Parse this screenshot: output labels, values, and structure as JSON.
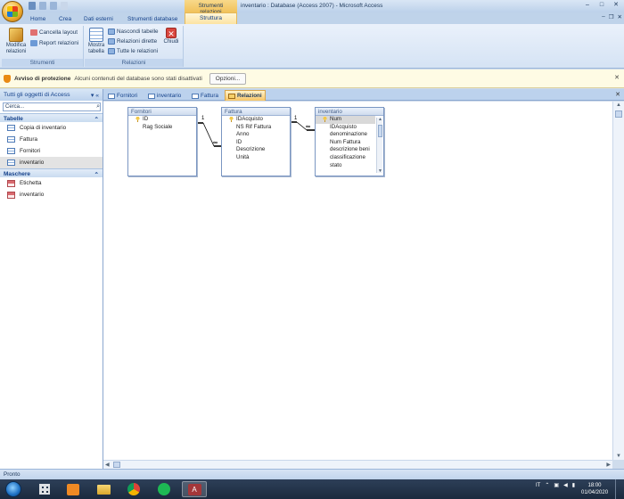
{
  "titlebar": {
    "context_tab": "Strumenti relazioni",
    "title": "inventario : Database (Access 2007) - Microsoft Access",
    "controls": [
      "–",
      "□",
      "✕"
    ]
  },
  "ribbon_tabs": [
    "Home",
    "Crea",
    "Dati esterni",
    "Strumenti database",
    "Struttura"
  ],
  "ribbon_active_tab": "Struttura",
  "ribbon": {
    "strumenti": {
      "label": "Strumenti",
      "modifica": "Modifica relazioni",
      "cancella": "Cancella layout",
      "report": "Report relazioni"
    },
    "relazioni": {
      "label": "Relazioni",
      "mostra": "Mostra tabella",
      "nascondi": "Nascondi tabelle",
      "dirette": "Relazioni dirette",
      "tutte": "Tutte le relazioni",
      "chiudi": "Chiudi"
    }
  },
  "security": {
    "title": "Avviso di protezione",
    "message": "Alcuni contenuti del database sono stati disattivati",
    "button": "Opzioni..."
  },
  "nav": {
    "header": "Tutti gli oggetti di Access",
    "search_placeholder": "Cerca...",
    "sections": [
      {
        "label": "Tabelle",
        "items": [
          "Copia di inventario",
          "Fattura",
          "Fornitori",
          "inventario"
        ]
      },
      {
        "label": "Maschere",
        "items": [
          "Etichetta",
          "inventario"
        ]
      }
    ],
    "selected": "inventario"
  },
  "doc_tabs": [
    "Fornitori",
    "inventario",
    "Fattura",
    "Relazioni"
  ],
  "doc_active_tab": "Relazioni",
  "relations": {
    "tables": [
      {
        "name": "Fornitori",
        "fields": [
          "ID",
          "Rag Sociale"
        ],
        "key_field": "ID"
      },
      {
        "name": "Fattura",
        "fields": [
          "IDAcquisto",
          "NS Rif Fattura",
          "Anno",
          "ID",
          "Descrizione",
          "Unità"
        ],
        "key_field": "IDAcquisto"
      },
      {
        "name": "inventario",
        "fields": [
          "Num",
          "IDAcquisto",
          "denominazione",
          "Num Fattura",
          "descrizione beni",
          "classificazione",
          "stato"
        ],
        "key_field": "Num"
      }
    ],
    "links": [
      {
        "from": "Fornitori.ID",
        "to": "Fattura.ID",
        "one": "1",
        "many": "∞"
      },
      {
        "from": "Fattura.IDAcquisto",
        "to": "inventario.IDAcquisto",
        "one": "1",
        "many": "∞"
      }
    ]
  },
  "status": "Pronto",
  "taskbar": {
    "language": "IT",
    "time": "18:00",
    "date": "01/04/2020"
  },
  "colors": {
    "ribbon_active": "#fce3a2",
    "context_tab": "#f1c15a",
    "taskbar": "#1b2a3e"
  }
}
